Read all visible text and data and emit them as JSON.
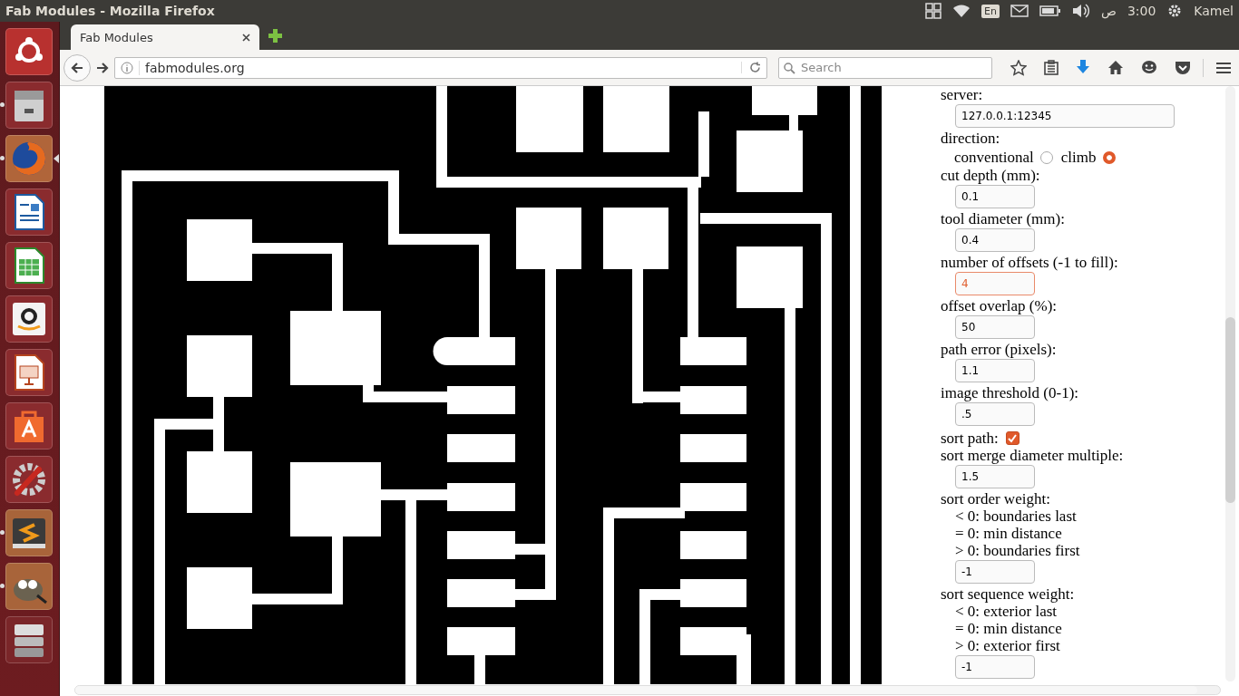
{
  "top_panel": {
    "window_title": "Fab Modules - Mozilla Firefox",
    "keyboard_layout": "En",
    "clock_suffix": "ص",
    "clock": "3:00",
    "user": "Kamel"
  },
  "launcher": {
    "items": [
      {
        "kind": "ubuntu",
        "running": false,
        "focused": false
      },
      {
        "kind": "files",
        "running": true,
        "focused": false
      },
      {
        "kind": "firefox",
        "running": true,
        "focused": true
      },
      {
        "kind": "writer",
        "running": false,
        "focused": false
      },
      {
        "kind": "calc",
        "running": false,
        "focused": false
      },
      {
        "kind": "amazon",
        "running": false,
        "focused": false
      },
      {
        "kind": "impress",
        "running": false,
        "focused": false
      },
      {
        "kind": "software",
        "running": false,
        "focused": false
      },
      {
        "kind": "settings",
        "running": false,
        "focused": false
      },
      {
        "kind": "sublime",
        "running": true,
        "focused": false
      },
      {
        "kind": "gimp",
        "running": true,
        "focused": false
      },
      {
        "kind": "drives",
        "running": false,
        "focused": false
      }
    ]
  },
  "browser": {
    "tab": {
      "title": "Fab Modules"
    },
    "url": "fabmodules.org",
    "search": {
      "placeholder": "Search"
    }
  },
  "form": [
    {
      "kind": "label",
      "text": "server:"
    },
    {
      "kind": "field",
      "value": "127.0.0.1:12345",
      "wide": true,
      "focused": false
    },
    {
      "kind": "label",
      "text": "direction:"
    },
    {
      "kind": "radios",
      "options": [
        {
          "label": "conventional",
          "selected": false
        },
        {
          "label": "climb",
          "selected": true
        }
      ]
    },
    {
      "kind": "label",
      "text": "cut depth (mm):"
    },
    {
      "kind": "field",
      "value": "0.1",
      "wide": false,
      "focused": false
    },
    {
      "kind": "label",
      "text": "tool diameter (mm):"
    },
    {
      "kind": "field",
      "value": "0.4",
      "wide": false,
      "focused": false
    },
    {
      "kind": "label",
      "text": "number of offsets (-1 to fill):"
    },
    {
      "kind": "field",
      "value": "4",
      "wide": false,
      "focused": true
    },
    {
      "kind": "label",
      "text": "offset overlap (%):"
    },
    {
      "kind": "field",
      "value": "50",
      "wide": false,
      "focused": false
    },
    {
      "kind": "label",
      "text": "path error (pixels):"
    },
    {
      "kind": "field",
      "value": "1.1",
      "wide": false,
      "focused": false
    },
    {
      "kind": "label",
      "text": "image threshold (0-1):"
    },
    {
      "kind": "field",
      "value": ".5",
      "wide": false,
      "focused": false
    },
    {
      "kind": "checkbox",
      "text": "sort path:",
      "checked": true
    },
    {
      "kind": "label",
      "text": "sort merge diameter multiple:"
    },
    {
      "kind": "field",
      "value": "1.5",
      "wide": false,
      "focused": false
    },
    {
      "kind": "label",
      "text": "sort order weight:"
    },
    {
      "kind": "note",
      "text": "< 0: boundaries last"
    },
    {
      "kind": "note",
      "text": "= 0: min distance"
    },
    {
      "kind": "note",
      "text": "> 0: boundaries first"
    },
    {
      "kind": "field",
      "value": "-1",
      "wide": false,
      "focused": false
    },
    {
      "kind": "label",
      "text": "sort sequence weight:"
    },
    {
      "kind": "note",
      "text": "< 0: exterior last"
    },
    {
      "kind": "note",
      "text": "= 0: min distance"
    },
    {
      "kind": "note",
      "text": "> 0: exterior first"
    },
    {
      "kind": "field",
      "value": "-1",
      "wide": false,
      "focused": false
    }
  ]
}
